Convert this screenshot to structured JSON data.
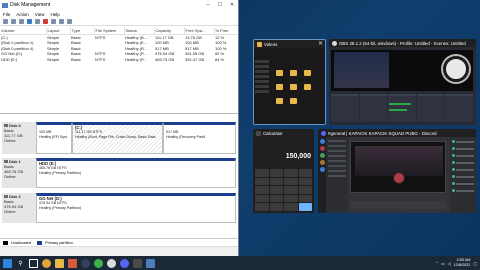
{
  "disk_management": {
    "title": "Disk Management",
    "menu": [
      "File",
      "Action",
      "View",
      "Help"
    ],
    "columns": [
      "Volume",
      "Layout",
      "Type",
      "File System",
      "Status",
      "Capacity",
      "Free Spa...",
      "% Free"
    ],
    "volumes": [
      [
        "(C:)",
        "Simple",
        "Basic",
        "NTFS",
        "Healthy (B...",
        "111.17 GB",
        "13.76 GB",
        "12 %"
      ],
      [
        "(Disk 0 partition 1)",
        "Simple",
        "Basic",
        "",
        "Healthy (E...",
        "100 MB",
        "100 MB",
        "100 %"
      ],
      [
        "(Disk 0 partition 4)",
        "Simple",
        "Basic",
        "",
        "Healthy (R...",
        "517 MB",
        "517 MB",
        "100 %"
      ],
      [
        "GG Net (D:)",
        "Simple",
        "Basic",
        "NTFS",
        "Healthy (P...",
        "476.94 GB",
        "391.55 GB",
        "82 %"
      ],
      [
        "HDD (E:)",
        "Simple",
        "Basic",
        "NTFS",
        "Healthy (P...",
        "465.75 GB",
        "391.47 GB",
        "84 %"
      ]
    ],
    "disks": [
      {
        "name": "Disk 0",
        "type": "Basic",
        "size": "111.77 GB",
        "status": "Online",
        "partitions": [
          {
            "label": "",
            "size": "100 MB",
            "status": "Healthy (EFI Syst"
          },
          {
            "label": "(C:)",
            "size": "111.17 GB NTFS",
            "status": "Healthy (Boot, Page File, Crash Dump, Basic Data"
          },
          {
            "label": "",
            "size": "517 MB",
            "status": "Healthy (Recovery Partit"
          }
        ]
      },
      {
        "name": "Disk 1",
        "type": "Basic",
        "size": "465.76 GB",
        "status": "Online",
        "partitions": [
          {
            "label": "HDD (E:)",
            "size": "465.76 GB NTFS",
            "status": "Healthy (Primary Partition)"
          }
        ]
      },
      {
        "name": "Disk 2",
        "type": "Basic",
        "size": "476.94 GB",
        "status": "Online",
        "partitions": [
          {
            "label": "GG Net (D:)",
            "size": "476.94 GB NTFS",
            "status": "Healthy (Primary Partition)"
          }
        ]
      }
    ],
    "legend": [
      "Unallocated",
      "Primary partition"
    ]
  },
  "snap_cards": {
    "videos": {
      "title": "Videos"
    },
    "obs": {
      "title": "OBS 28.1.2 (64-bit, windows) - Profile: Untitled - Scenes: Untitled"
    },
    "calculator": {
      "title": "Calculator",
      "display": "150,000"
    },
    "discord": {
      "title": "#general | KAPACIK KAPACIK SQUAD PUBG - Discord"
    }
  },
  "taskbar": {
    "time": "2:55 AM",
    "date": "12/8/2022"
  },
  "colors": {
    "primary_partition": "#1d3d8f",
    "unallocated": "#000000",
    "taskbar": "#1b2838"
  }
}
